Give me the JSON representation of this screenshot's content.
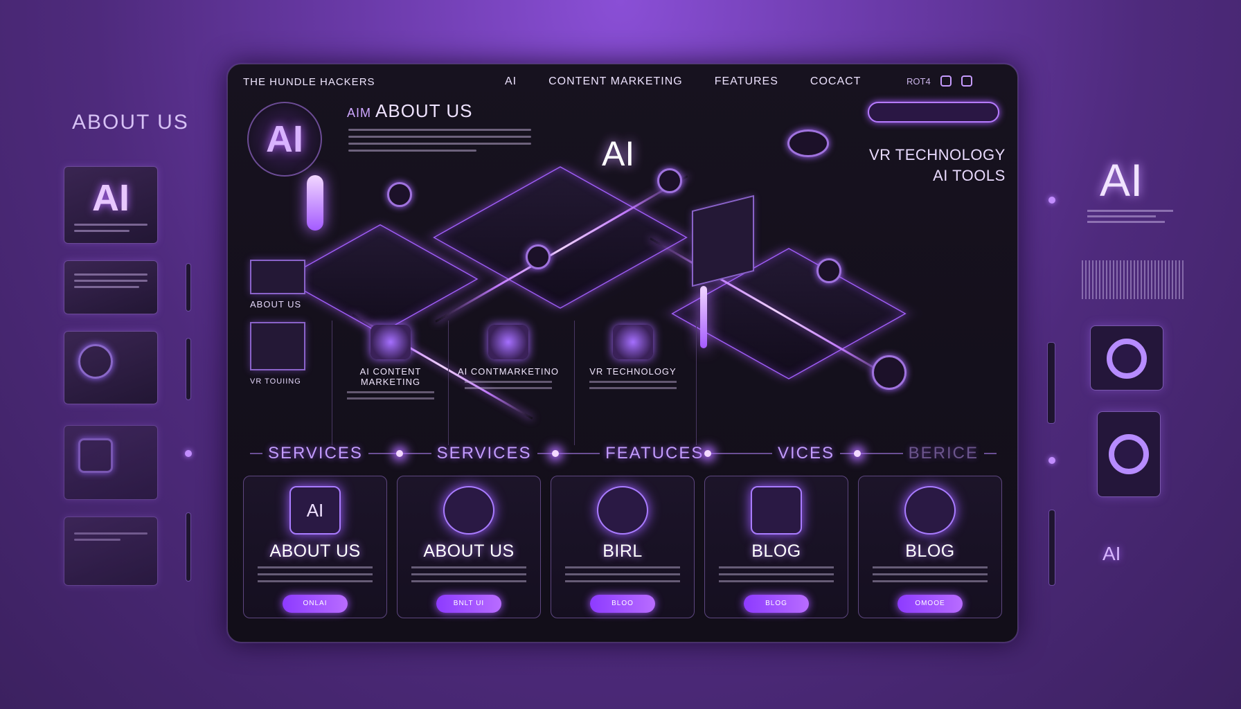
{
  "side": {
    "title": "ABOUT US",
    "thumb_ai": "AI"
  },
  "right": {
    "ai": "AI",
    "ai_small": "AI"
  },
  "nav": {
    "brand": "THE HUNDLE HACKERS",
    "links": [
      "AI",
      "CONTENT MARKETING",
      "FEATURES",
      "COCACT"
    ],
    "misc": "ROT4"
  },
  "hero": {
    "logo": "AI",
    "about_pre": "AIM",
    "about_title": "ABOUT US",
    "center_ai": "AI",
    "vr_line1": "VR TECHNOLOGY",
    "vr_line2": "AI TOOLS",
    "mini_about": "ABOUT US",
    "mini_vr": "VR TOUIING"
  },
  "features": [
    {
      "title": "AI CONTENT MARKETING"
    },
    {
      "title": "AI CONTMARKETINO"
    },
    {
      "title": "VR TECHNOLOGY"
    }
  ],
  "sections": [
    "SERVICES",
    "SERVICES",
    "FEATUCES",
    "VICES",
    "BERICE"
  ],
  "cards": [
    {
      "icon": "AI",
      "title": "ABOUT US",
      "button": "ONLAI"
    },
    {
      "icon": "",
      "title": "ABOUT US",
      "button": "BNLT UI"
    },
    {
      "icon": "",
      "title": "BIRL",
      "button": "BLOO"
    },
    {
      "icon": "",
      "title": "BLOG",
      "button": "BLOG"
    },
    {
      "icon": "",
      "title": "BLOG",
      "button": "OMOOE"
    }
  ],
  "colors": {
    "accent": "#b46bff",
    "background": "#120e19",
    "button": "#8d3bff"
  }
}
